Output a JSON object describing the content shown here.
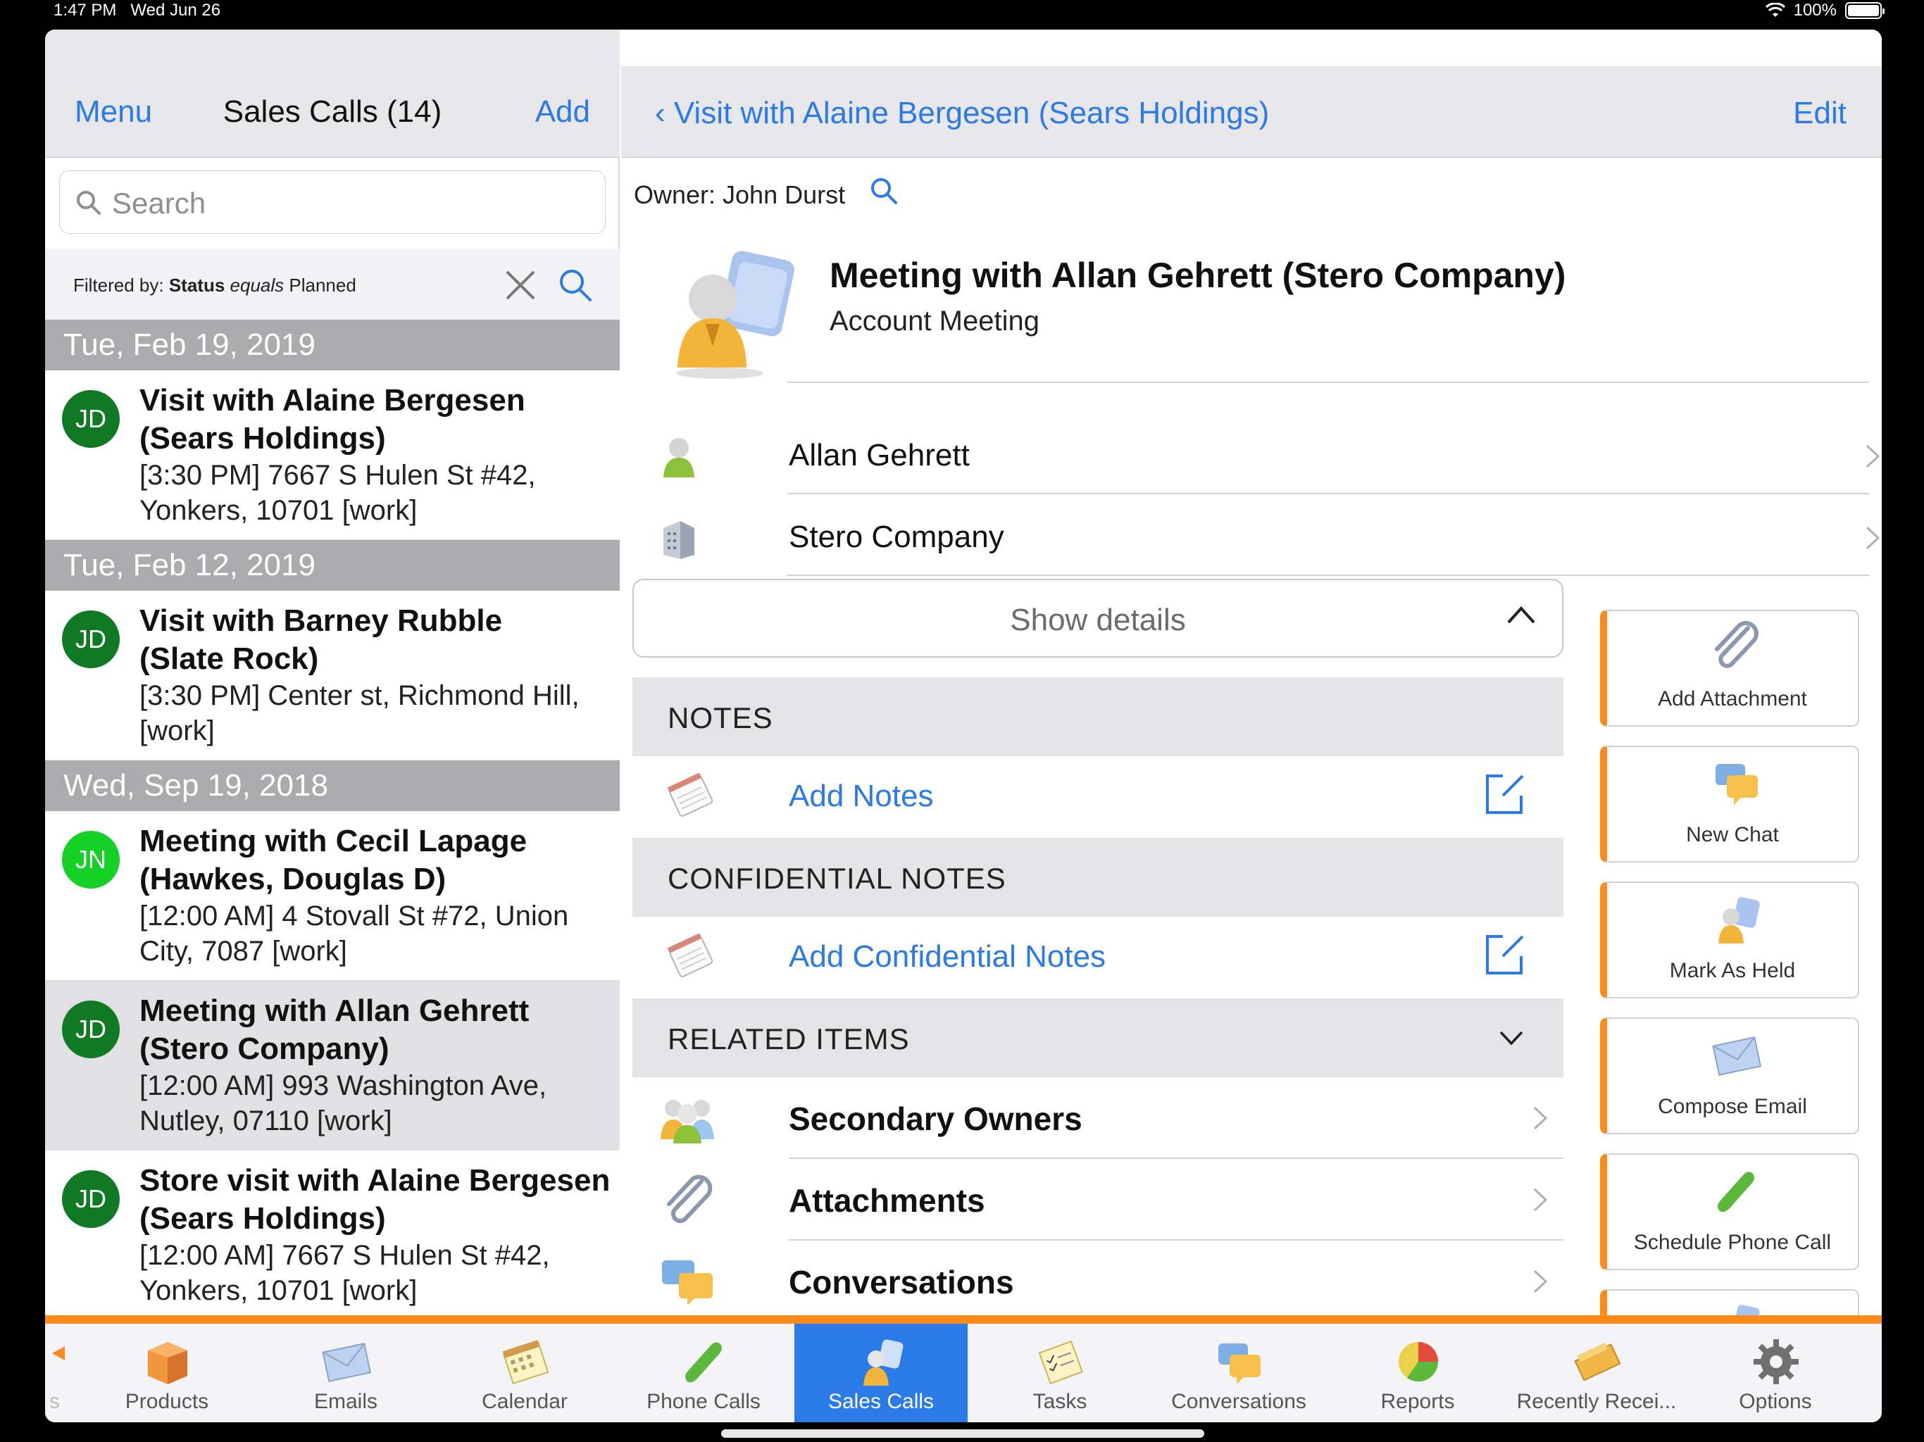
{
  "status": {
    "time": "1:47 PM",
    "date": "Wed Jun 26",
    "battery": "100%"
  },
  "left_nav": {
    "menu": "Menu",
    "title": "Sales Calls (14)",
    "add": "Add"
  },
  "search": {
    "placeholder": "Search"
  },
  "filter": {
    "prefix": "Filtered by: ",
    "field": "Status",
    "op": "equals",
    "value": "Planned"
  },
  "sections": [
    {
      "date": "Tue, Feb 19, 2019",
      "items": [
        {
          "initials": "JD",
          "title1": "Visit with Alaine Bergesen",
          "title2": "(Sears Holdings)",
          "d1": "[3:30 PM] 7667 S Hulen St #42,",
          "d2": "Yonkers, 10701 [work]"
        }
      ]
    },
    {
      "date": "Tue, Feb 12, 2019",
      "items": [
        {
          "initials": "JD",
          "title1": "Visit with Barney Rubble",
          "title2": "(Slate Rock)",
          "d1": "[3:30 PM] Center st, Richmond Hill,",
          "d2": "[work]"
        }
      ]
    },
    {
      "date": "Wed, Sep 19, 2018",
      "items": [
        {
          "initials": "JN",
          "title1": "Meeting with Cecil Lapage",
          "title2": "(Hawkes, Douglas D)",
          "d1": "[12:00 AM] 4 Stovall St #72, Union",
          "d2": "City, 7087 [work]"
        },
        {
          "initials": "JD",
          "title1": "Meeting with Allan Gehrett",
          "title2": "(Stero Company)",
          "d1": "[12:00 AM] 993 Washington Ave,",
          "d2": "Nutley, 07110 [work]"
        },
        {
          "initials": "JD",
          "title1": "Store visit with Alaine Bergesen",
          "title2": "(Sears Holdings)",
          "d1": "[12:00 AM] 7667 S Hulen St #42,",
          "d2": "Yonkers, 10701 [work]"
        }
      ]
    }
  ],
  "right_nav": {
    "back": "‹ Visit with Alaine Bergesen (Sears Holdings)",
    "edit": "Edit"
  },
  "owner": "Owner: John Durst",
  "detail": {
    "title": "Meeting with Allan Gehrett (Stero Company)",
    "subtitle": "Account Meeting",
    "contact": "Allan Gehrett",
    "company": "Stero Company"
  },
  "show_details": "Show details",
  "notes": {
    "header": "NOTES",
    "add": "Add Notes"
  },
  "conf_notes": {
    "header": "CONFIDENTIAL NOTES",
    "add": "Add Confidential Notes"
  },
  "related": {
    "header": "RELATED ITEMS",
    "items": [
      "Secondary Owners",
      "Attachments",
      "Conversations"
    ]
  },
  "actions": [
    "Add Attachment",
    "New Chat",
    "Mark As Held",
    "Compose Email",
    "Schedule Phone Call"
  ],
  "tabs": [
    "Products",
    "Emails",
    "Calendar",
    "Phone Calls",
    "Sales Calls",
    "Tasks",
    "Conversations",
    "Reports",
    "Recently Recei...",
    "Options"
  ],
  "tab_partial": "s",
  "colors": {
    "accent": "#2a7ae8",
    "orange": "#ff8a1c",
    "avatar_green": "#0f7a23",
    "avatar_light": "#15d126"
  }
}
